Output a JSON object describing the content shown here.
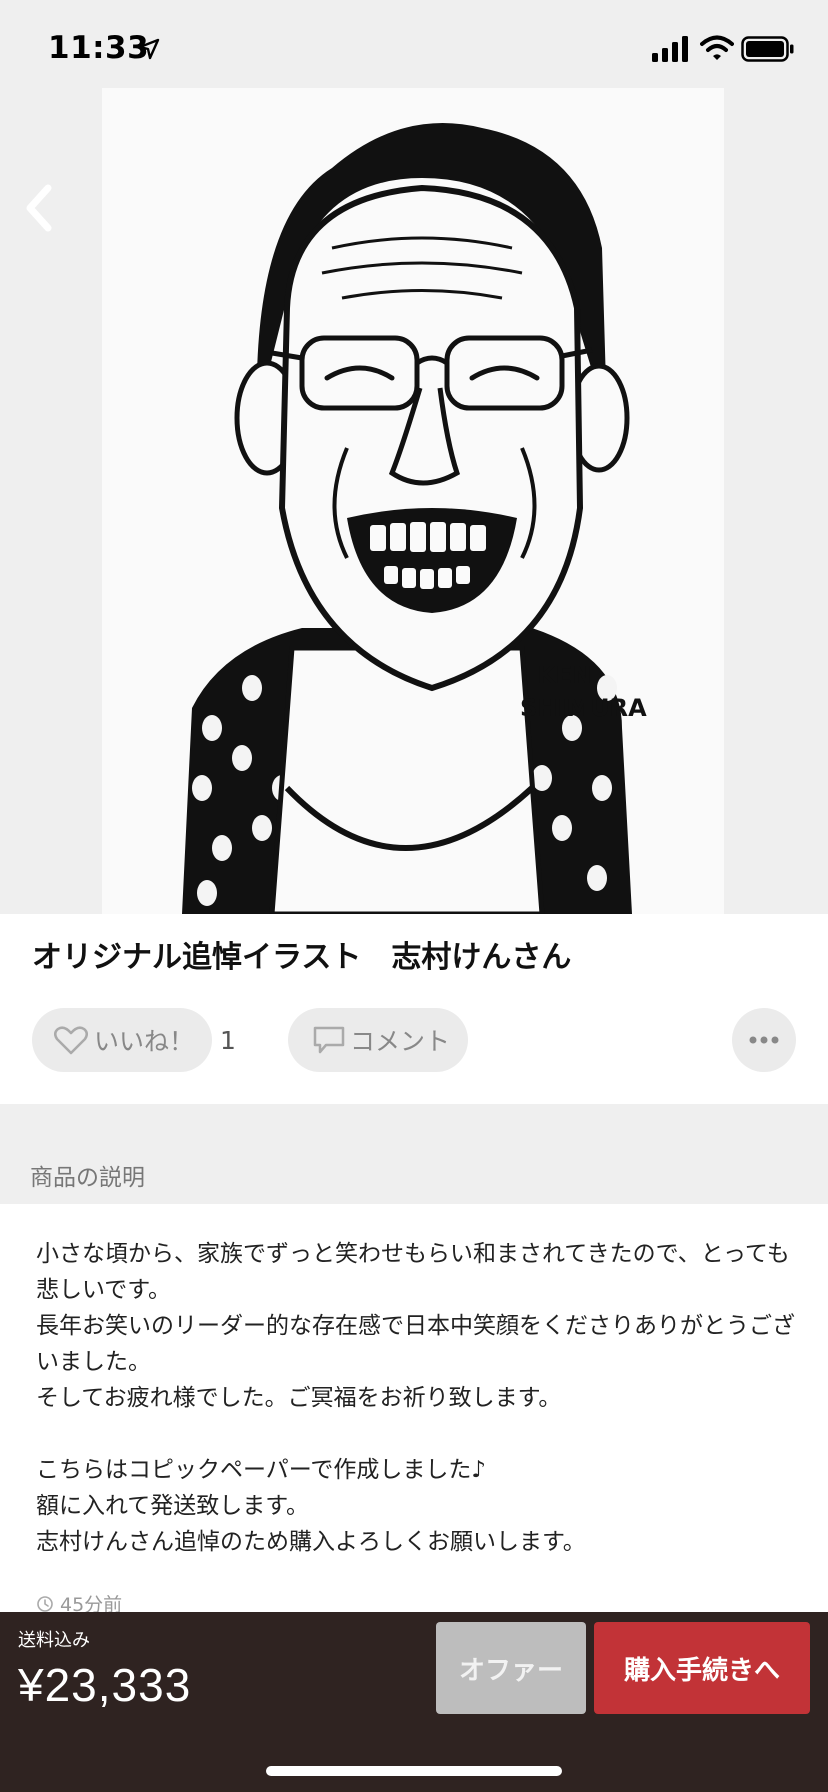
{
  "status_bar": {
    "time": "11:33",
    "icons": [
      "location-arrow-icon",
      "signal-icon",
      "wifi-icon",
      "battery-icon"
    ]
  },
  "product_image": {
    "subject_name_drawn": "KEN SHIMURA"
  },
  "navigation": {
    "back_icon": "chevron-left-icon"
  },
  "item": {
    "title": "オリジナル追悼イラスト　志村けんさん",
    "like_label": "いいね！",
    "like_count": "1",
    "comment_label": "コメント",
    "more_icon": "ellipsis-icon"
  },
  "section": {
    "title": "商品の説明"
  },
  "description": "小さな頃から、家族でずっと笑わせもらい和まされてきたので、とっても悲しいです。\n長年お笑いのリーダー的な存在感で日本中笑顔をくださりありがとうございました。\nそしてお疲れ様でした。ご冥福をお祈り致します。\n\nこちらはコピックペーパーで作成しました♪\n額に入れて発送致します。\n志村けんさん追悼のため購入よろしくお願いします。",
  "timestamp": "45分前",
  "bottom_bar": {
    "shipping_label": "送料込み",
    "price": "¥23,333",
    "offer_label": "オファー",
    "purchase_label": "購入手続きへ"
  },
  "colors": {
    "purchase_button": "#c23337",
    "bottom_bar": "#2f2321",
    "offer_button": "#bdbdbd"
  }
}
